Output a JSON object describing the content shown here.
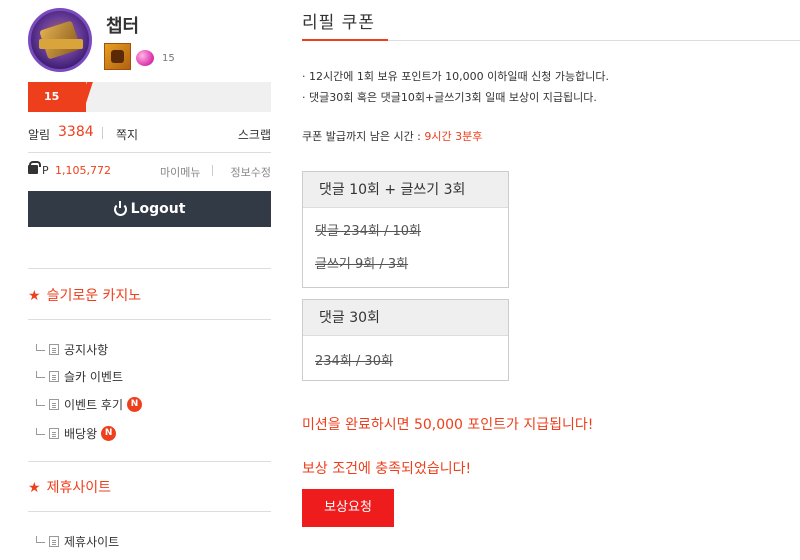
{
  "profile": {
    "nickname": "챕터",
    "gem_count": "15",
    "level": "15",
    "level_progress_fraction": 0.24
  },
  "stats": {
    "alarm_label": "알림",
    "alarm_value": "3384",
    "message_label": "쪽지",
    "scrap_label": "스크랩"
  },
  "points": {
    "label": "P",
    "value": "1,105,772",
    "my_menu": "마이메뉴",
    "edit_info": "정보수정"
  },
  "logout_label": "Logout",
  "sidebar": {
    "section1_title": "슬기로운 카지노",
    "section1_items": [
      {
        "label": "공지사항",
        "new": false
      },
      {
        "label": "슬카 이벤트",
        "new": false
      },
      {
        "label": "이벤트 후기",
        "new": true
      },
      {
        "label": "배당왕",
        "new": true
      }
    ],
    "section2_title": "제휴사이트",
    "section2_items": [
      {
        "label": "제휴사이트",
        "new": false
      }
    ],
    "new_badge": "N"
  },
  "main": {
    "title": "리필 쿠폰",
    "notes": [
      "· 12시간에 1회 보유 포인트가 10,000 이하일때 신청 가능합니다.",
      "· 댓글30회 혹은 댓글10회+글쓰기3회 일때 보상이 지급됩니다."
    ],
    "remain_label": "쿠폰 발급까지 남은 시간 : ",
    "remain_time": "9시간 3분후",
    "box1": {
      "title": "댓글 10회 + 글쓰기 3회",
      "rows": [
        "댓글 234회 / 10회",
        "글쓰기 9회 / 3회"
      ]
    },
    "box2": {
      "title": "댓글 30회",
      "rows": [
        "234회 / 30회"
      ]
    },
    "mission_text": "미션을 완료하시면 50,000 포인트가 지급됩니다!",
    "achieved_text": "보상 조건에 충족되었습니다!",
    "reward_button": "보상요청"
  },
  "colors": {
    "accent": "#ee3f1c",
    "logout_bg": "#323a45",
    "reward_button": "#ee1c1c"
  }
}
